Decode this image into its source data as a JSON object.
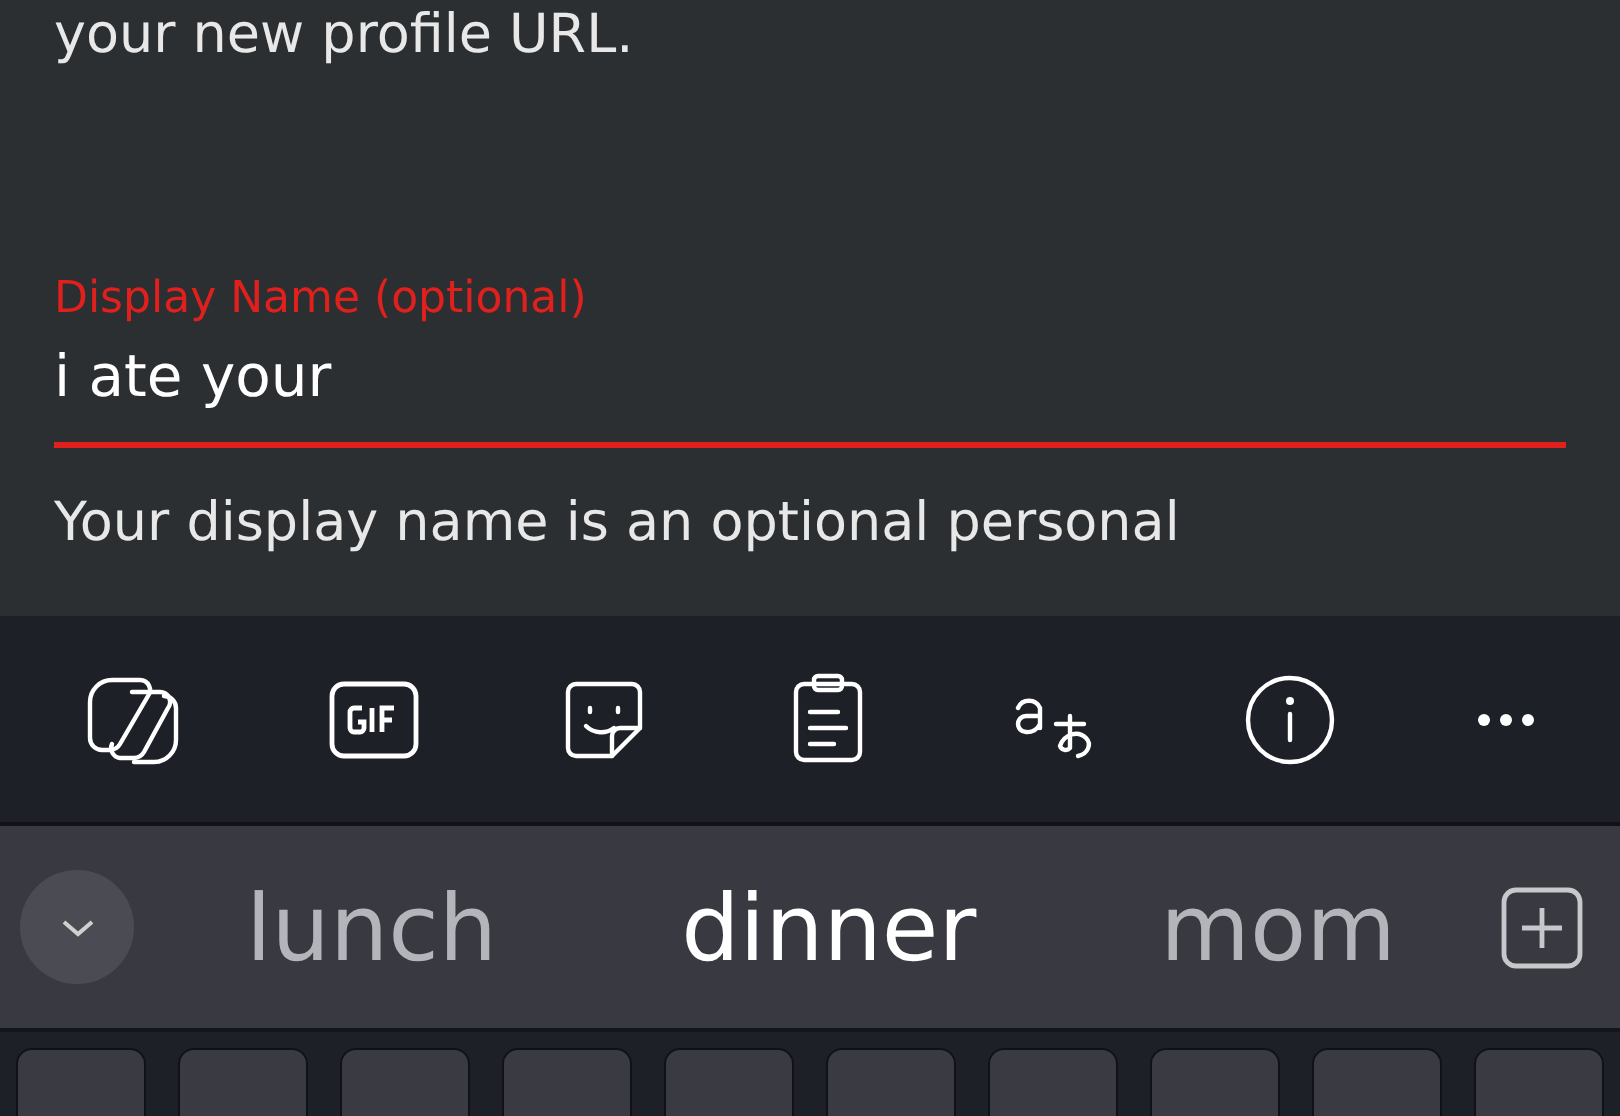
{
  "form": {
    "intro_text": "your new profile URL.",
    "field": {
      "label": "Display Name (optional)",
      "value": "i ate your",
      "focused": true
    },
    "helper_text": "Your display name is an optional personal"
  },
  "keyboard_toolbar": {
    "tools": [
      {
        "kind": "copilot"
      },
      {
        "kind": "gif"
      },
      {
        "kind": "sticker"
      },
      {
        "kind": "clipboard"
      },
      {
        "kind": "translate"
      },
      {
        "kind": "info"
      },
      {
        "kind": "more"
      }
    ]
  },
  "suggestions": [
    {
      "text": "lunch",
      "selected": false
    },
    {
      "text": "dinner",
      "selected": true
    },
    {
      "text": "mom",
      "selected": false
    }
  ]
}
